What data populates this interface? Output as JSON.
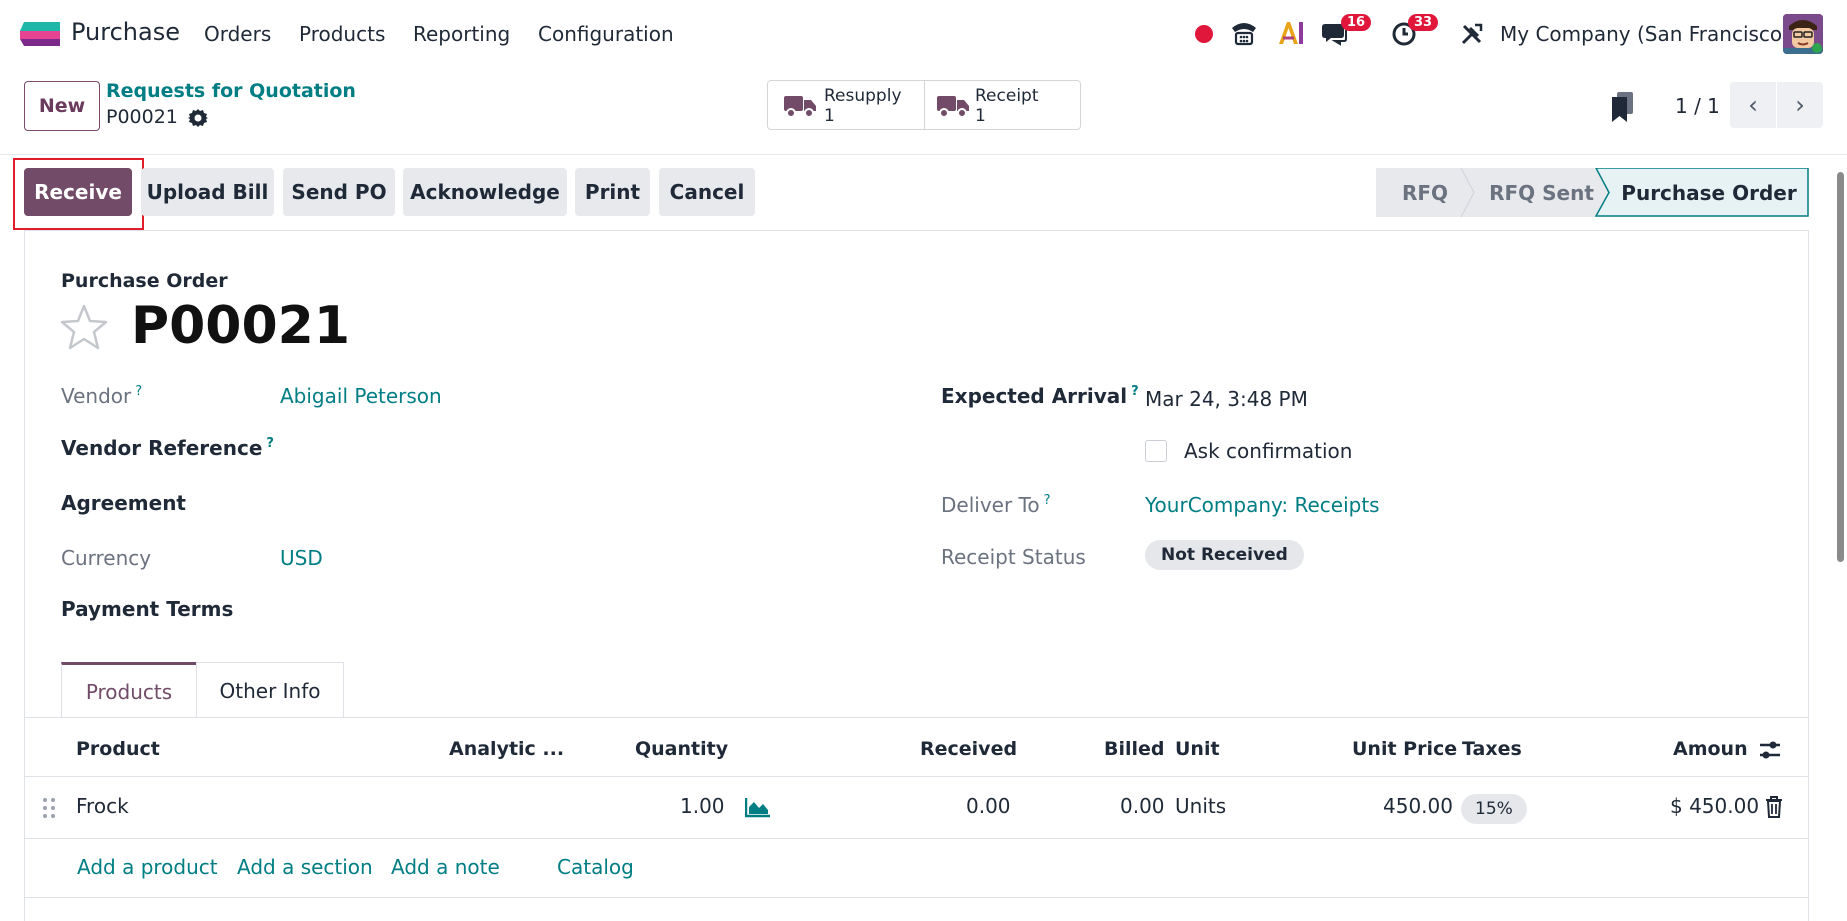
{
  "navbar": {
    "app_name": "Purchase",
    "menu": [
      "Orders",
      "Products",
      "Reporting",
      "Configuration"
    ],
    "messages_count": "16",
    "activities_count": "33",
    "company": "My Company (San Francisco)"
  },
  "control": {
    "new_label": "New",
    "breadcrumb_parent": "Requests for Quotation",
    "breadcrumb_current": "P00021",
    "smart_buttons": [
      {
        "label": "Resupply",
        "count": "1"
      },
      {
        "label": "Receipt",
        "count": "1"
      }
    ],
    "pager": "1 / 1"
  },
  "actions": [
    "Receive",
    "Upload Bill",
    "Send PO",
    "Acknowledge",
    "Print",
    "Cancel"
  ],
  "statusbar": {
    "stages": [
      "RFQ",
      "RFQ Sent",
      "Purchase Order"
    ],
    "active": "Purchase Order"
  },
  "form": {
    "title_label": "Purchase Order",
    "name": "P00021",
    "vendor_label": "Vendor",
    "vendor": "Abigail Peterson",
    "vendor_ref_label": "Vendor Reference",
    "agreement_label": "Agreement",
    "currency_label": "Currency",
    "currency": "USD",
    "payment_terms_label": "Payment Terms",
    "expected_arrival_label": "Expected Arrival",
    "expected_arrival": "Mar 24, 3:48 PM",
    "ask_confirmation_label": "Ask confirmation",
    "deliver_to_label": "Deliver To",
    "deliver_to": "YourCompany: Receipts",
    "receipt_status_label": "Receipt Status",
    "receipt_status": "Not Received",
    "help_mark": "?"
  },
  "tabs": [
    "Products",
    "Other Info"
  ],
  "lines": {
    "columns": [
      "Product",
      "Analytic ...",
      "Quantity",
      "Received",
      "Billed",
      "Unit",
      "Unit Price",
      "Taxes",
      "Amount"
    ],
    "rows": [
      {
        "product": "Frock",
        "quantity": "1.00",
        "received": "0.00",
        "billed": "0.00",
        "unit": "Units",
        "unit_price": "450.00",
        "taxes": "15%",
        "amount": "$ 450.00"
      }
    ],
    "add_links": [
      "Add a product",
      "Add a section",
      "Add a note",
      "Catalog"
    ]
  },
  "colors": {
    "brand": "#714b67",
    "link": "#017e84",
    "badge": "#e0163a",
    "highlight": "#e11d2a"
  }
}
